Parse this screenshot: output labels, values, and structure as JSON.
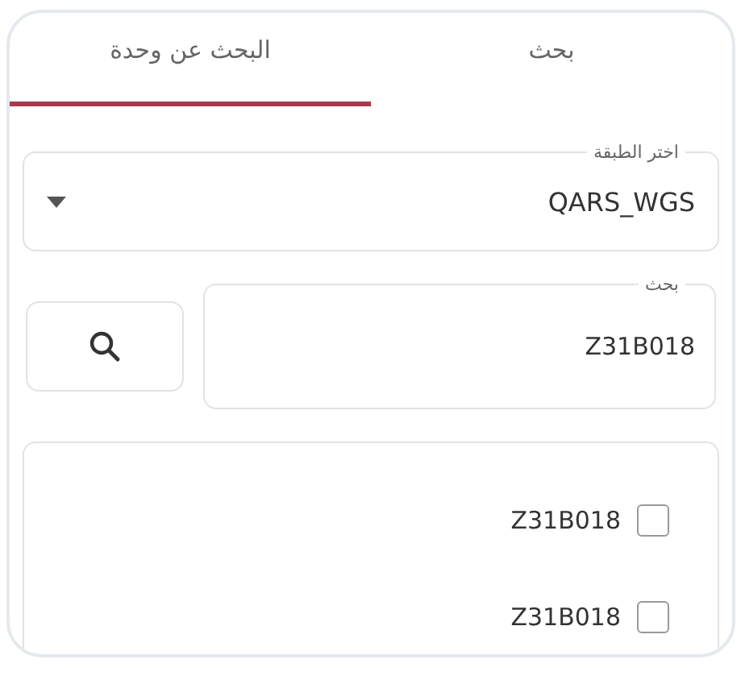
{
  "tabs": [
    {
      "label": "بحث",
      "selected": false
    },
    {
      "label": "البحث عن وحدة",
      "selected": true
    }
  ],
  "layer_select": {
    "label": "اختر الطبقة",
    "value": "QARS_WGS"
  },
  "search": {
    "label": "بحث",
    "value": "Z31B018"
  },
  "results": [
    {
      "label": "Z31B018",
      "checked": false
    },
    {
      "label": "Z31B018",
      "checked": false
    }
  ]
}
